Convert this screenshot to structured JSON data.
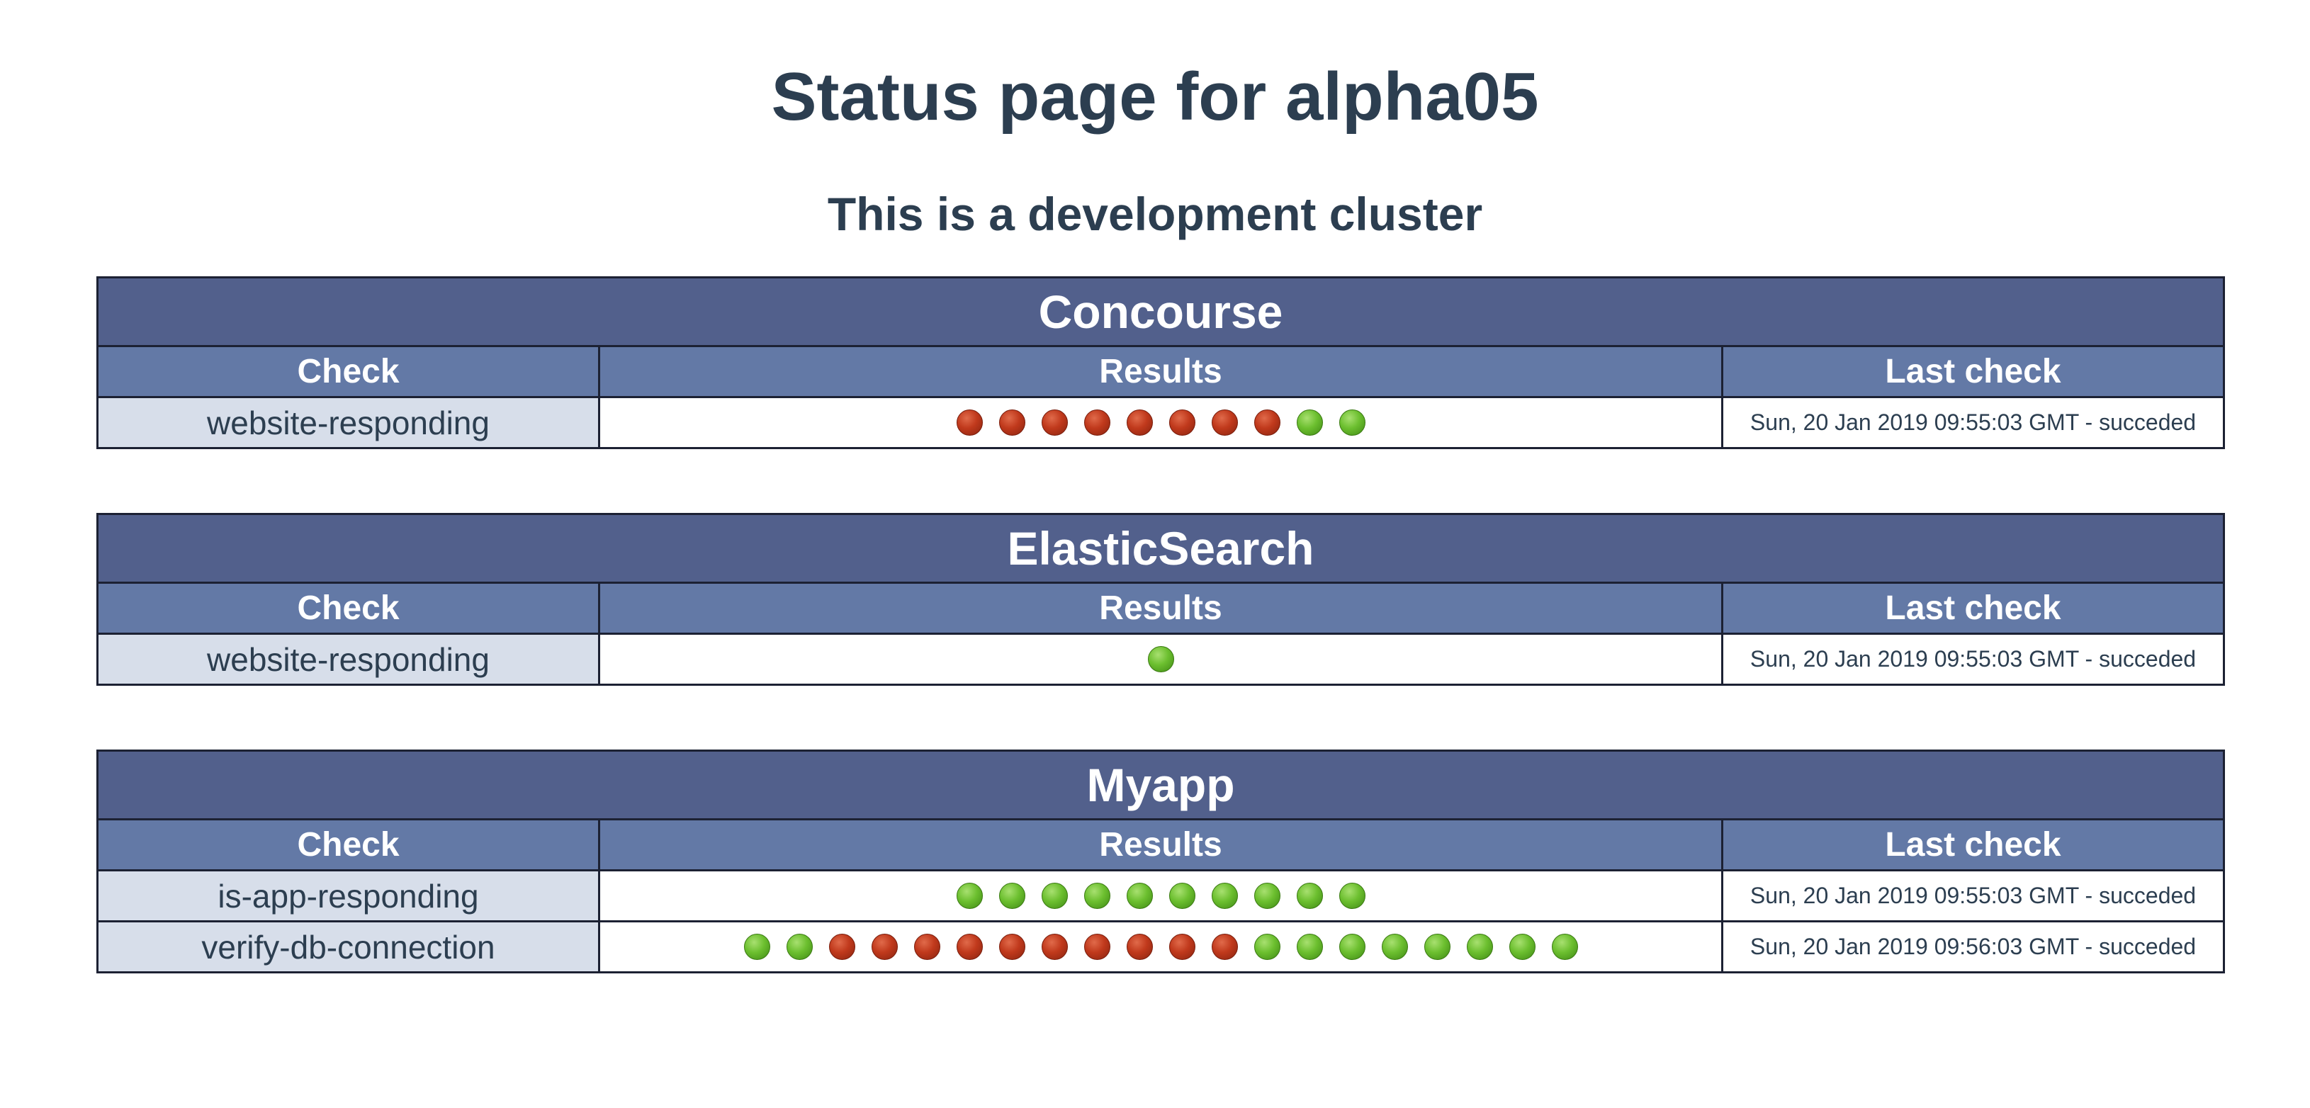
{
  "title": "Status page for alpha05",
  "subtitle": "This is a development cluster",
  "columns": {
    "check": "Check",
    "results": "Results",
    "last_check": "Last check"
  },
  "colors": {
    "title_bar": "#52608c",
    "header_row": "#6379a6",
    "check_cell": "#d7deea",
    "success": "#6cbf2f",
    "failure": "#c0391c",
    "text": "#2c3e50"
  },
  "sections": [
    {
      "name": "Concourse",
      "checks": [
        {
          "name": "website-responding",
          "results": [
            "fail",
            "fail",
            "fail",
            "fail",
            "fail",
            "fail",
            "fail",
            "fail",
            "ok",
            "ok"
          ],
          "last_check": "Sun, 20 Jan 2019 09:55:03 GMT - succeded"
        }
      ]
    },
    {
      "name": "ElasticSearch",
      "checks": [
        {
          "name": "website-responding",
          "results": [
            "ok"
          ],
          "last_check": "Sun, 20 Jan 2019 09:55:03 GMT - succeded"
        }
      ]
    },
    {
      "name": "Myapp",
      "checks": [
        {
          "name": "is-app-responding",
          "results": [
            "ok",
            "ok",
            "ok",
            "ok",
            "ok",
            "ok",
            "ok",
            "ok",
            "ok",
            "ok"
          ],
          "last_check": "Sun, 20 Jan 2019 09:55:03 GMT - succeded"
        },
        {
          "name": "verify-db-connection",
          "results": [
            "ok",
            "ok",
            "fail",
            "fail",
            "fail",
            "fail",
            "fail",
            "fail",
            "fail",
            "fail",
            "fail",
            "fail",
            "ok",
            "ok",
            "ok",
            "ok",
            "ok",
            "ok",
            "ok",
            "ok"
          ],
          "last_check": "Sun, 20 Jan 2019 09:56:03 GMT - succeded"
        }
      ]
    }
  ]
}
